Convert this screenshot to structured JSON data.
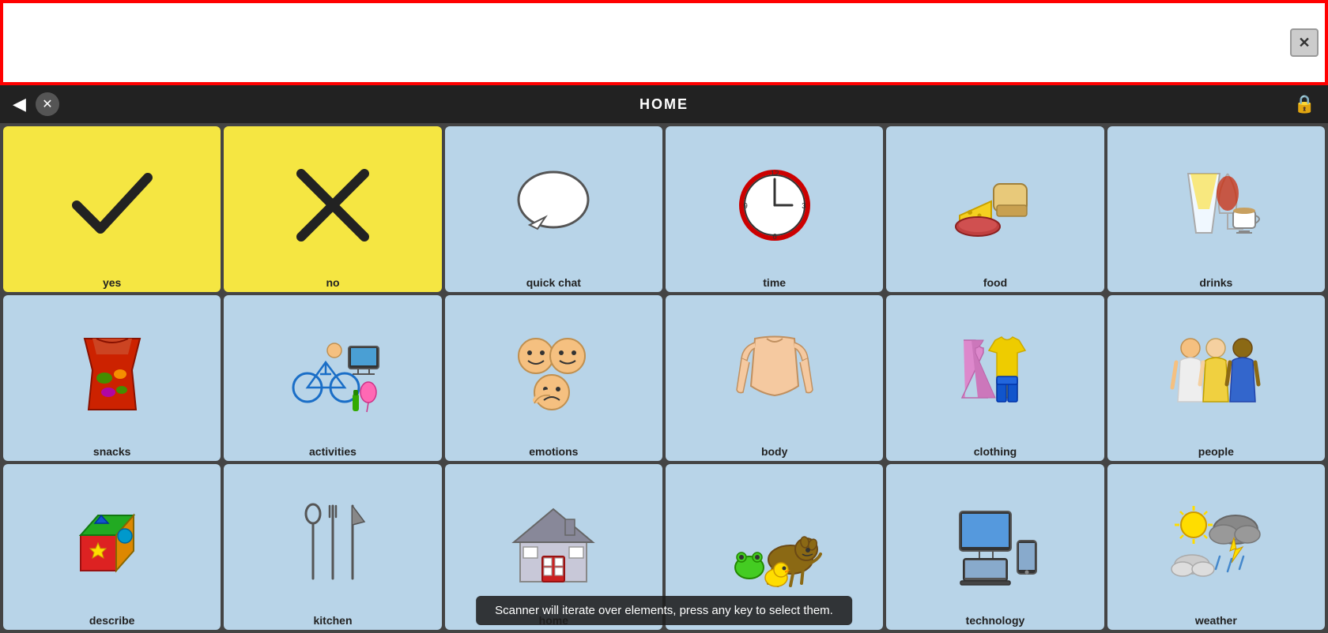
{
  "topBar": {
    "closeLabel": "✕"
  },
  "navBar": {
    "title": "HOME",
    "backLabel": "◀",
    "cancelLabel": "✕",
    "lockLabel": "🔒"
  },
  "grid": {
    "cells": [
      {
        "id": "yes",
        "label": "yes",
        "color": "yellow",
        "icon": "yes"
      },
      {
        "id": "no",
        "label": "no",
        "color": "yellow",
        "icon": "no"
      },
      {
        "id": "quick-chat",
        "label": "quick chat",
        "color": "blue",
        "icon": "quick-chat"
      },
      {
        "id": "time",
        "label": "time",
        "color": "blue",
        "icon": "time"
      },
      {
        "id": "food",
        "label": "food",
        "color": "blue",
        "icon": "food"
      },
      {
        "id": "drinks",
        "label": "drinks",
        "color": "blue",
        "icon": "drinks"
      },
      {
        "id": "snacks",
        "label": "snacks",
        "color": "blue",
        "icon": "snacks"
      },
      {
        "id": "activities",
        "label": "activities",
        "color": "blue",
        "icon": "activities"
      },
      {
        "id": "emotions",
        "label": "emotions",
        "color": "blue",
        "icon": "emotions"
      },
      {
        "id": "body",
        "label": "body",
        "color": "blue",
        "icon": "body"
      },
      {
        "id": "clothing",
        "label": "clothing",
        "color": "blue",
        "icon": "clothing"
      },
      {
        "id": "people",
        "label": "people",
        "color": "blue",
        "icon": "people"
      },
      {
        "id": "describe",
        "label": "describe",
        "color": "blue",
        "icon": "describe"
      },
      {
        "id": "kitchen",
        "label": "kitchen",
        "color": "blue",
        "icon": "kitchen"
      },
      {
        "id": "home",
        "label": "home",
        "color": "blue",
        "icon": "home"
      },
      {
        "id": "animals",
        "label": "animals",
        "color": "blue",
        "icon": "animals"
      },
      {
        "id": "technology",
        "label": "technology",
        "color": "blue",
        "icon": "technology"
      },
      {
        "id": "weather",
        "label": "weather",
        "color": "blue",
        "icon": "weather"
      }
    ]
  },
  "tooltip": {
    "text": "Scanner will iterate over elements, press any key to select them."
  }
}
